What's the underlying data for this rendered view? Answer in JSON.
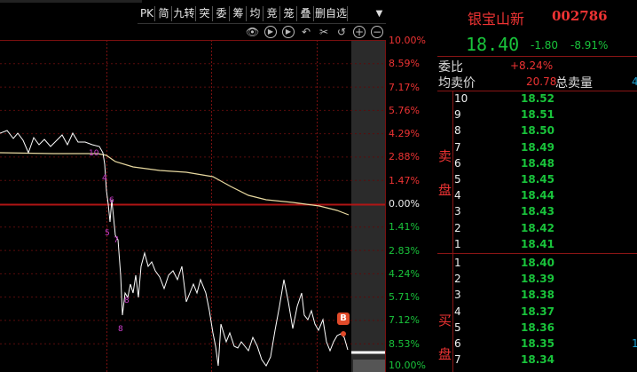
{
  "toolbar": {
    "buttons": [
      "PK",
      "简",
      "九转",
      "突",
      "委",
      "筹",
      "均",
      "竞",
      "笼",
      "叠",
      "删自选"
    ],
    "dropdown": "▼"
  },
  "chart_icons": [
    "eye-icon",
    "play-icon",
    "play-icon",
    "undo-icon",
    "scissors-icon",
    "undo-icon",
    "zoom-in-icon",
    "zoom-out-icon"
  ],
  "y_axis_labels": [
    "10.00%",
    "8.59%",
    "7.17%",
    "5.76%",
    "4.29%",
    "2.88%",
    "1.47%",
    "0.00%",
    "1.41%",
    "2.83%",
    "4.24%",
    "5.71%",
    "7.12%",
    "8.53%",
    "10.00%"
  ],
  "chart_markers": [
    "10",
    "4",
    "5",
    "6",
    "7",
    "8",
    "8"
  ],
  "b_marker": "B",
  "stock": {
    "name": "银宝山新",
    "code": "002786",
    "price": "18.40",
    "change": "-1.80",
    "change_pct": "-8.91%"
  },
  "stats": {
    "weibi_label": "委比",
    "weibi_value": "+8.24%",
    "junmaijia_label": "均卖价",
    "junmaijia_value": "20.78",
    "zongmailiang_label": "总卖量",
    "zongmailiang_value": "4"
  },
  "sell_side": {
    "label_1": "卖",
    "label_2": "盘",
    "rows": [
      {
        "idx": "10",
        "price": "18.52"
      },
      {
        "idx": "9",
        "price": "18.51"
      },
      {
        "idx": "8",
        "price": "18.50"
      },
      {
        "idx": "7",
        "price": "18.49"
      },
      {
        "idx": "6",
        "price": "18.48"
      },
      {
        "idx": "5",
        "price": "18.45"
      },
      {
        "idx": "4",
        "price": "18.44"
      },
      {
        "idx": "3",
        "price": "18.43"
      },
      {
        "idx": "2",
        "price": "18.42"
      },
      {
        "idx": "1",
        "price": "18.41"
      }
    ]
  },
  "buy_side": {
    "label_1": "买",
    "label_2": "盘",
    "rows": [
      {
        "idx": "1",
        "price": "18.40"
      },
      {
        "idx": "2",
        "price": "18.39"
      },
      {
        "idx": "3",
        "price": "18.38"
      },
      {
        "idx": "4",
        "price": "18.37"
      },
      {
        "idx": "5",
        "price": "18.36"
      },
      {
        "idx": "6",
        "price": "18.35",
        "extra": "1"
      },
      {
        "idx": "7",
        "price": "18.34"
      }
    ]
  },
  "colors": {
    "up": "#e33333",
    "down": "#19c43b",
    "price_line": "#ffffff",
    "avg_line": "#e8d9a0",
    "grid": "#7a1010",
    "marker": "#d040d0"
  }
}
